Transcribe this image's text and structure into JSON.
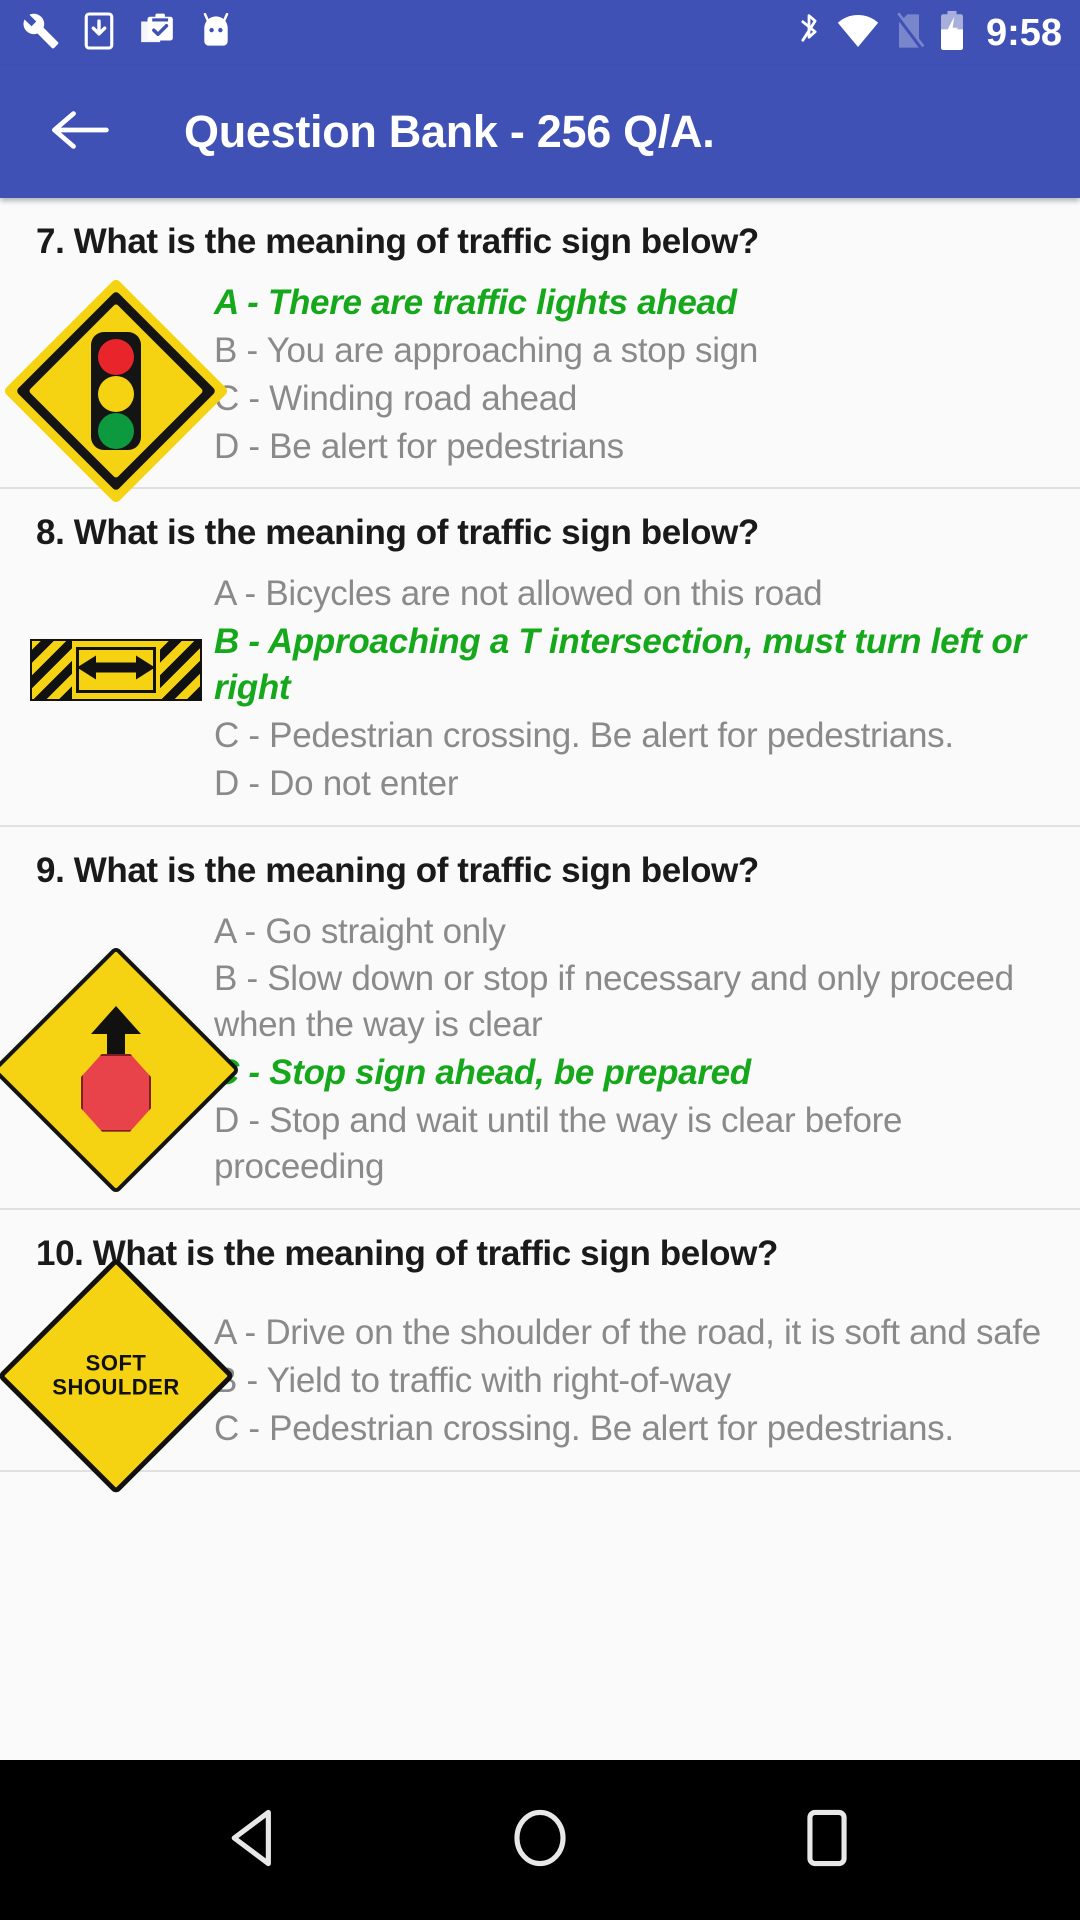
{
  "status_bar": {
    "icons_left": [
      "wrench-icon",
      "phone-download-icon",
      "clipboard-check-icon",
      "android-bugdroid-icon"
    ],
    "icons_right": [
      "bluetooth-icon",
      "wifi-icon",
      "no-sim-icon",
      "battery-charging-icon"
    ],
    "time": "9:58",
    "background_color": "#3f51b5"
  },
  "app_bar": {
    "back_icon": "arrow-left-icon",
    "title": "Question Bank - 256 Q/A.",
    "background_color": "#3f51b5",
    "text_color": "#ffffff"
  },
  "colors": {
    "correct_answer": "#15a81b",
    "answer_text": "#8a8a8a",
    "question_text": "#1a1a1a",
    "sign_yellow": "#f5d312",
    "sign_red": "#e8252b",
    "sign_green": "#0d9a3e",
    "page_background": "#fafafa",
    "nav_bar": "#000000"
  },
  "questions": [
    {
      "number": "7.",
      "prompt": "7. What is the meaning of traffic sign below?",
      "sign": "traffic-light-warning-sign",
      "answers": [
        {
          "text": "A - There are traffic lights ahead",
          "correct": true
        },
        {
          "text": "B - You are approaching a stop sign",
          "correct": false
        },
        {
          "text": "C - Winding road ahead",
          "correct": false
        },
        {
          "text": "D - Be alert for pedestrians",
          "correct": false
        }
      ]
    },
    {
      "number": "8.",
      "prompt": "8. What is the meaning of traffic sign below?",
      "sign": "t-intersection-marker-sign",
      "answers": [
        {
          "text": "A - Bicycles are not allowed on this road",
          "correct": false
        },
        {
          "text": "B - Approaching a T intersection, must turn left or right",
          "correct": true
        },
        {
          "text": "C - Pedestrian crossing. Be alert for pedestrians.",
          "correct": false
        },
        {
          "text": "D - Do not enter",
          "correct": false
        }
      ]
    },
    {
      "number": "9.",
      "prompt": "9. What is the meaning of traffic sign below?",
      "sign": "stop-ahead-warning-sign",
      "answers": [
        {
          "text": "A - Go straight only",
          "correct": false
        },
        {
          "text": "B - Slow down or stop if necessary and only proceed when the way is clear",
          "correct": false
        },
        {
          "text": "C - Stop sign ahead, be prepared",
          "correct": true
        },
        {
          "text": "D - Stop and wait until the way is clear before proceeding",
          "correct": false
        }
      ]
    },
    {
      "number": "10.",
      "prompt": "10. What is the meaning of traffic sign below?",
      "sign": "soft-shoulder-sign",
      "sign_text_line1": "SOFT",
      "sign_text_line2": "SHOULDER",
      "answers": [
        {
          "text": "A - Drive on the shoulder of the road, it is soft and safe",
          "correct": false
        },
        {
          "text": "B - Yield to traffic with right-of-way",
          "correct": false
        },
        {
          "text": "C - Pedestrian crossing. Be alert for pedestrians.",
          "correct": false
        }
      ]
    }
  ],
  "nav_bar": {
    "back_label": "back-triangle-icon",
    "home_label": "home-circle-icon",
    "recents_label": "recents-square-icon"
  }
}
